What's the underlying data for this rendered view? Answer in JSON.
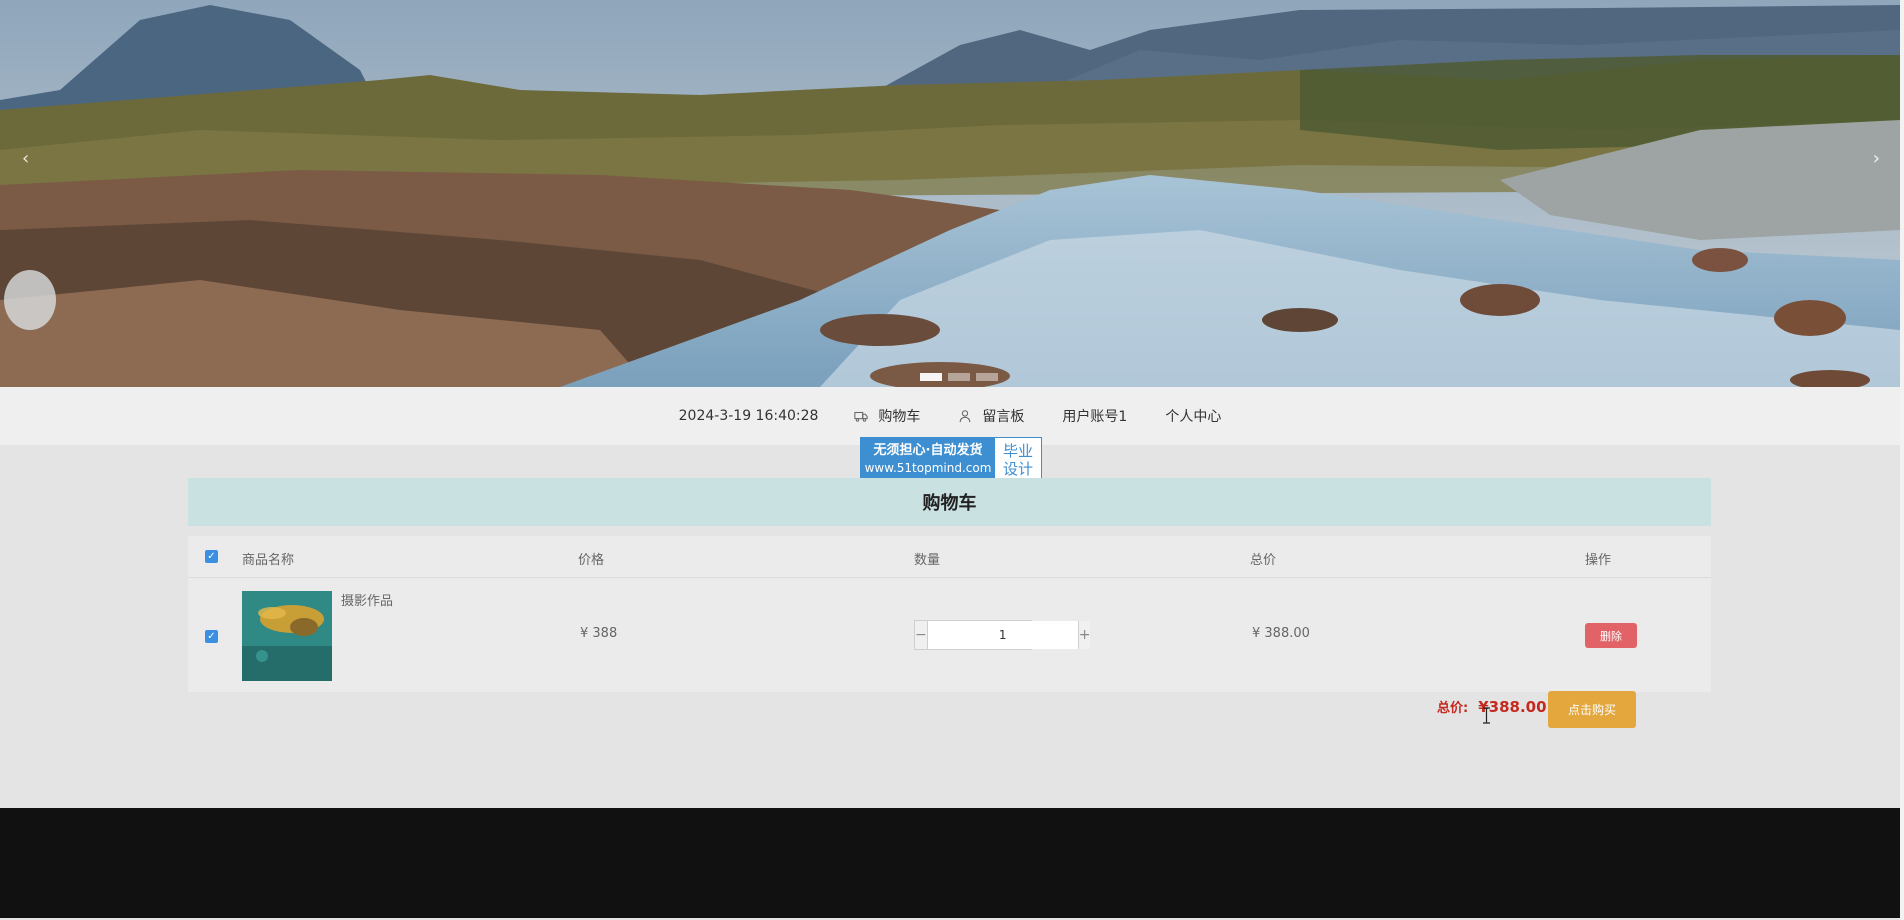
{
  "banner": {
    "slides": 3,
    "active_slide": 1,
    "prev_arrow": "‹",
    "next_arrow": "›"
  },
  "nav": {
    "datetime": "2024-3-19 16:40:28",
    "items": [
      {
        "label": "购物车",
        "icon": "truck-icon"
      },
      {
        "label": "留言板",
        "icon": "user-icon"
      },
      {
        "label": "用户账号1",
        "icon": ""
      },
      {
        "label": "个人中心",
        "icon": ""
      }
    ]
  },
  "watermark": {
    "line1": "无须担心·自动发货",
    "line2": "www.51topmind.com",
    "right1": "毕业",
    "right2": "设计"
  },
  "cart": {
    "title": "购物车",
    "headers": {
      "name": "商品名称",
      "price": "价格",
      "quantity": "数量",
      "total": "总价",
      "action": "操作"
    },
    "items": [
      {
        "name": "摄影作品",
        "price": "¥ 388",
        "quantity": "1",
        "total": "¥ 388.00",
        "delete_label": "删除",
        "checked": true
      }
    ],
    "select_all_checked": true,
    "minus_symbol": "−",
    "plus_symbol": "+",
    "checkmark": "✓"
  },
  "summary": {
    "total_label": "总价:",
    "total_value": "¥388.00",
    "buy_label": "点击购买"
  },
  "colors": {
    "accent_blue": "#3b8ee0",
    "title_bar": "#cae1e2",
    "delete_red": "#e26367",
    "buy_orange": "#e3a73e",
    "total_red": "#c42a1f"
  }
}
